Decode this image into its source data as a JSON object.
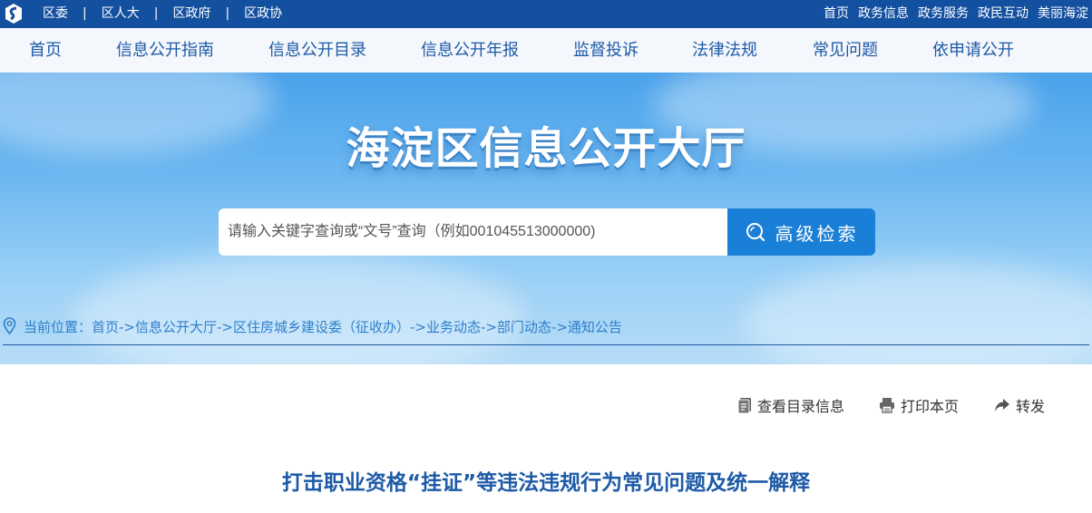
{
  "topbar": {
    "left_links": [
      "区委",
      "区人大",
      "区政府",
      "区政协"
    ],
    "right_links": [
      "首页",
      "政务信息",
      "政务服务",
      "政民互动",
      "美丽海淀"
    ]
  },
  "nav": {
    "items": [
      "首页",
      "信息公开指南",
      "信息公开目录",
      "信息公开年报",
      "监督投诉",
      "法律法规",
      "常见问题",
      "依申请公开"
    ]
  },
  "hero": {
    "title": "海淀区信息公开大厅",
    "search_placeholder": "请输入关键字查询或“文号”查询（例如001045513000000)",
    "search_button": "高级检索"
  },
  "breadcrumb": {
    "text": "当前位置：首页->信息公开大厅->区住房城乡建设委（征收办）->业务动态->部门动态->通知公告"
  },
  "tools": {
    "catalog": "查看目录信息",
    "print": "打印本页",
    "share": "转发"
  },
  "article": {
    "title": "打击职业资格“挂证”等违法违规行为常见问题及统一解释"
  },
  "colors": {
    "topbar_bg": "#1450a0",
    "nav_text": "#1d5aa7",
    "search_button_bg": "#1a7fd6",
    "title_color": "#1d5aa7"
  }
}
